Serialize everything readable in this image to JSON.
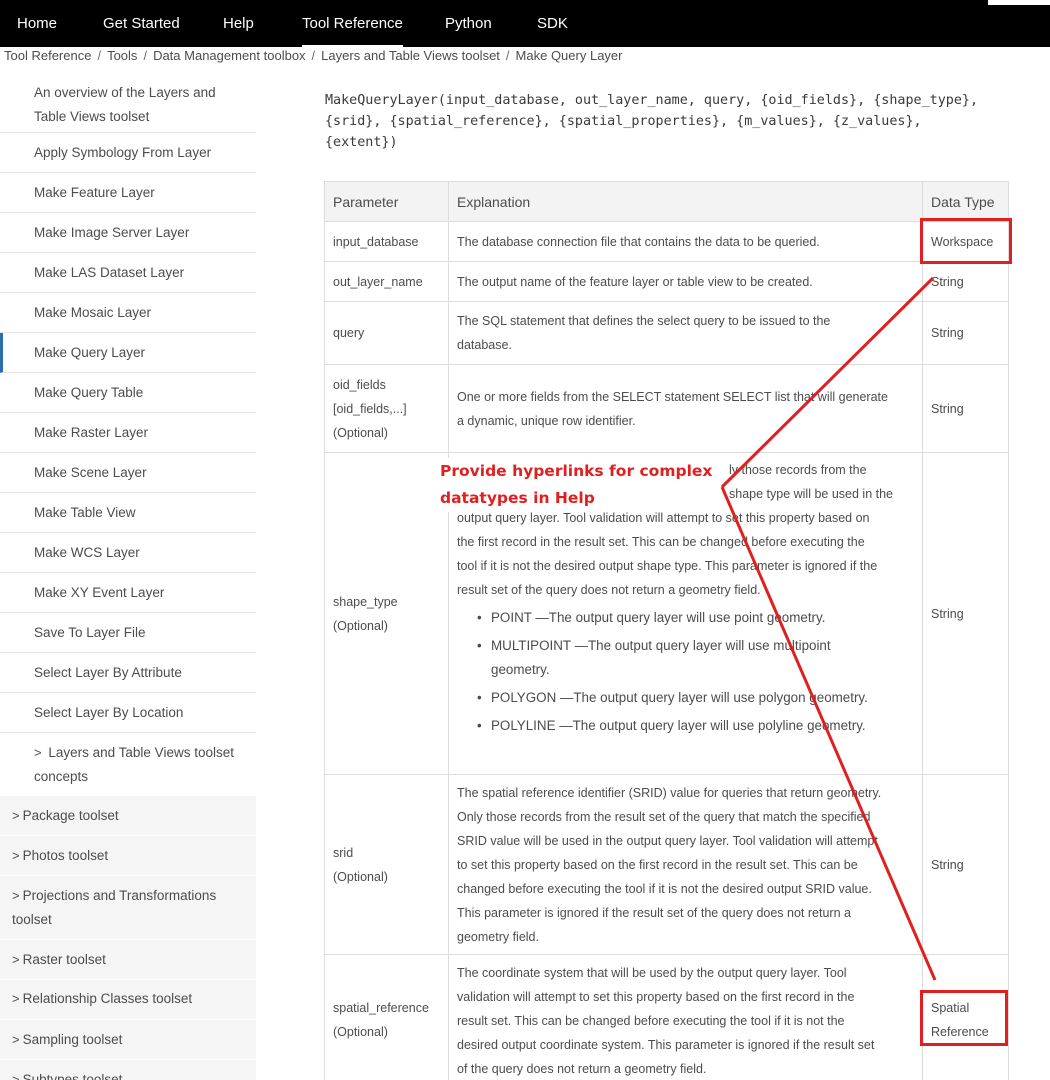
{
  "nav": {
    "items": [
      {
        "label": "Home"
      },
      {
        "label": "Get Started"
      },
      {
        "label": "Help"
      },
      {
        "label": "Tool Reference",
        "active": true
      },
      {
        "label": "Python"
      },
      {
        "label": "SDK"
      }
    ]
  },
  "breadcrumb": [
    "Tool Reference",
    "Tools",
    "Data Management toolbox",
    "Layers and Table Views toolset",
    "Make Query Layer"
  ],
  "sidebar": {
    "items": [
      {
        "label": "An overview of the Layers and Table Views toolset"
      },
      {
        "label": "Apply Symbology From Layer"
      },
      {
        "label": "Make Feature Layer"
      },
      {
        "label": "Make Image Server Layer"
      },
      {
        "label": "Make LAS Dataset Layer"
      },
      {
        "label": "Make Mosaic Layer"
      },
      {
        "label": "Make Query Layer",
        "current": true
      },
      {
        "label": "Make Query Table"
      },
      {
        "label": "Make Raster Layer"
      },
      {
        "label": "Make Scene Layer"
      },
      {
        "label": "Make Table View"
      },
      {
        "label": "Make WCS Layer"
      },
      {
        "label": "Make XY Event Layer"
      },
      {
        "label": "Save To Layer File"
      },
      {
        "label": "Select Layer By Attribute"
      },
      {
        "label": "Select Layer By Location"
      },
      {
        "label": "Layers and Table Views toolset concepts"
      },
      {
        "label": "Package toolset"
      },
      {
        "label": "Photos toolset"
      },
      {
        "label": "Projections and Transformations toolset"
      },
      {
        "label": "Raster toolset"
      },
      {
        "label": "Relationship Classes toolset"
      },
      {
        "label": "Sampling toolset"
      },
      {
        "label": "Subtypes toolset"
      }
    ]
  },
  "syntax": {
    "line1": "MakeQueryLayer(input_database, out_layer_name, query, {oid_fields}, {shape_type},",
    "line2": "{srid}, {spatial_reference}, {spatial_properties}, {m_values}, {z_values},",
    "line3": "{extent})"
  },
  "table": {
    "headers": {
      "param": "Parameter",
      "exp": "Explanation",
      "type": "Data Type"
    },
    "rows": [
      {
        "param": [
          "input_database"
        ],
        "exp": [
          "The database connection file that contains the data to be queried."
        ],
        "type": [
          "Workspace"
        ]
      },
      {
        "param": [
          "out_layer_name"
        ],
        "exp": [
          "The output name of the feature layer or table view to be created."
        ],
        "type": [
          "String"
        ]
      },
      {
        "param": [
          "query"
        ],
        "exp": [
          "The SQL statement that defines the select query to be issued to the",
          "database."
        ],
        "type": [
          "String"
        ]
      },
      {
        "param": [
          "oid_fields",
          "[oid_fields,...]",
          "(Optional)"
        ],
        "exp": [
          "One or more fields from the SELECT statement SELECT list that will generate",
          "a dynamic, unique row identifier."
        ],
        "type": [
          "String"
        ]
      },
      {
        "param": [
          "shape_type",
          "(Optional)"
        ],
        "exp": [
          "",
          "",
          "output query layer. Tool validation will attempt to set this property based on",
          "the first record in the result set. This can be changed before executing the",
          "tool if it is not the desired output shape type. This parameter is ignored if the",
          "result set of the query does not return a geometry field."
        ],
        "exp_partial": [
          "ly those records from the",
          "shape type will be used in the"
        ],
        "bullets": [
          [
            "POINT —The output query layer will use point geometry."
          ],
          [
            "MULTIPOINT —The output query layer will use multipoint",
            "geometry."
          ],
          [
            "POLYGON —The output query layer will use polygon geometry."
          ],
          [
            "POLYLINE —The output query layer will use polyline geometry."
          ]
        ],
        "type": [
          "String"
        ]
      },
      {
        "param": [
          "srid",
          "(Optional)"
        ],
        "exp": [
          "The spatial reference identifier (SRID) value for queries that return geometry.",
          "Only those records from the result set of the query that match the specified",
          "SRID value will be used in the output query layer. Tool validation will attempt",
          "to set this property based on the first record in the result set. This can be",
          "changed before executing the tool if it is not the desired output SRID value.",
          "This parameter is ignored if the result set of the query does not return a",
          "geometry field."
        ],
        "type": [
          "String"
        ]
      },
      {
        "param": [
          "spatial_reference",
          "(Optional)"
        ],
        "exp": [
          "The coordinate system that will be used by the output query layer. Tool",
          "validation will attempt to set this property based on the first record in the",
          "result set. This can be changed before executing the tool if it is not the",
          "desired output coordinate system. This parameter is ignored if the result set",
          "of the query does not return a geometry field."
        ],
        "type": [
          "Spatial",
          "Reference"
        ]
      }
    ]
  },
  "annotation": {
    "line1": "Provide hyperlinks for complex",
    "line2": "datatypes in Help",
    "color": "#e02020"
  },
  "colors": {
    "nav_bg": "#000000",
    "accent": "#2b6bb0",
    "annotation": "#e02020"
  }
}
